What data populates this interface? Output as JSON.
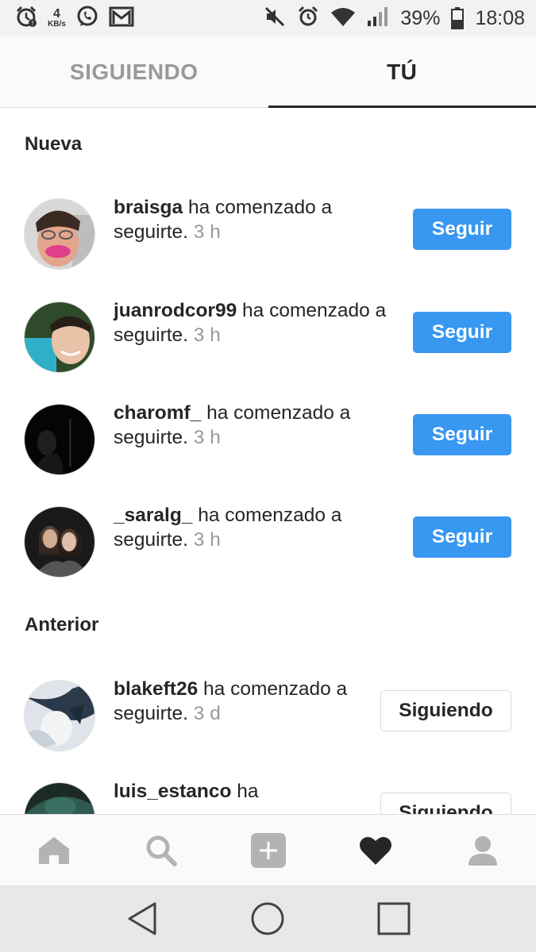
{
  "status_bar": {
    "speed_value": "4",
    "speed_unit": "KB/s",
    "battery": "39%",
    "time": "18:08"
  },
  "tabs": [
    {
      "label": "SIGUIENDO",
      "active": false
    },
    {
      "label": "TÚ",
      "active": true
    }
  ],
  "sections": {
    "new_title": "Nueva",
    "earlier_title": "Anterior"
  },
  "notifications": [
    {
      "username": "braisga",
      "action": "ha comenzado a seguirte.",
      "time": "3 h",
      "button": "Seguir"
    },
    {
      "username": "juanrodcor99",
      "action": "ha comenzado a seguirte.",
      "time": "3 h",
      "button": "Seguir"
    },
    {
      "username": "charomf_",
      "action": "ha comenzado a seguirte.",
      "time": "3 h",
      "button": "Seguir"
    },
    {
      "username": "_saralg_",
      "action": "ha comenzado a seguirte.",
      "time": "3 h",
      "button": "Seguir"
    },
    {
      "username": "blakeft26",
      "action": "ha comenzado a seguirte.",
      "time": "3 d",
      "button": "Siguiendo"
    },
    {
      "username": "luis_estanco",
      "action": "ha",
      "time": "",
      "button": "Siguiendo"
    }
  ],
  "bottom_nav": [
    "home-icon",
    "search-icon",
    "add-icon",
    "heart-icon",
    "profile-icon"
  ],
  "system_nav": [
    "back-icon",
    "home-circle-icon",
    "recents-icon"
  ],
  "colors": {
    "accent_blue": "#3897f0",
    "text_dark": "#262626",
    "text_muted": "#999999"
  }
}
